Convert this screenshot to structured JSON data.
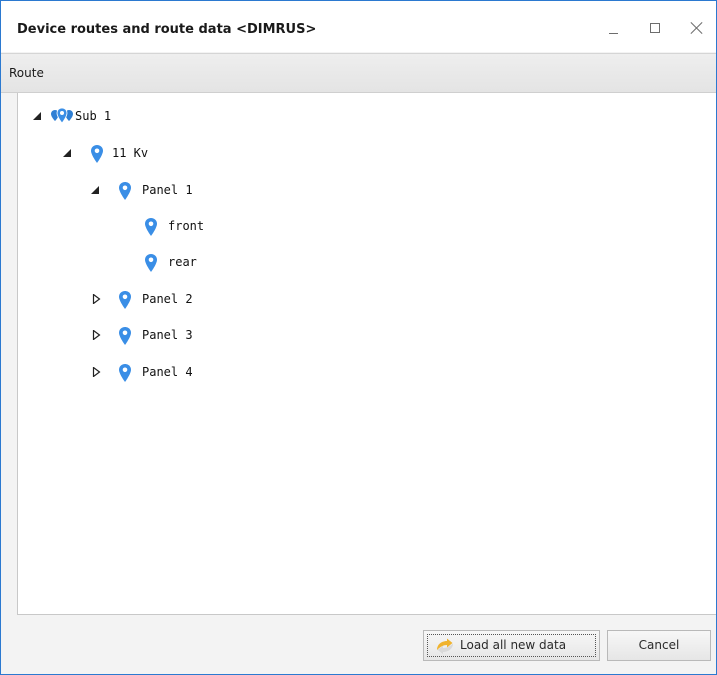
{
  "window": {
    "title": "Device routes and route data <DIMRUS>",
    "controls": {
      "minimize_icon": "minimize-icon",
      "maximize_icon": "maximize-icon",
      "close_icon": "close-icon"
    }
  },
  "column_header": {
    "label": "Route"
  },
  "tree": {
    "items": [
      {
        "label": "Sub 1",
        "depth": 0,
        "state": "expanded",
        "icon": "multi-location-pin-icon"
      },
      {
        "label": "11 Kv",
        "depth": 1,
        "state": "expanded",
        "icon": "location-pin-icon"
      },
      {
        "label": "Panel 1",
        "depth": 2,
        "state": "expanded",
        "icon": "location-pin-icon"
      },
      {
        "label": "front",
        "depth": 3,
        "state": "leaf",
        "icon": "location-pin-icon"
      },
      {
        "label": "rear",
        "depth": 3,
        "state": "leaf",
        "icon": "location-pin-icon"
      },
      {
        "label": "Panel 2",
        "depth": 2,
        "state": "collapsed",
        "icon": "location-pin-icon"
      },
      {
        "label": "Panel 3",
        "depth": 2,
        "state": "collapsed",
        "icon": "location-pin-icon"
      },
      {
        "label": "Panel 4",
        "depth": 2,
        "state": "collapsed",
        "icon": "location-pin-icon"
      }
    ]
  },
  "buttons": {
    "load_all": {
      "label": "Load all new data",
      "icon": "refresh-icon"
    },
    "cancel": {
      "label": "Cancel"
    }
  },
  "colors": {
    "window_border": "#2b79d0",
    "pin_blue": "#3a8ee6",
    "refresh_orange": "#f0b32e"
  }
}
